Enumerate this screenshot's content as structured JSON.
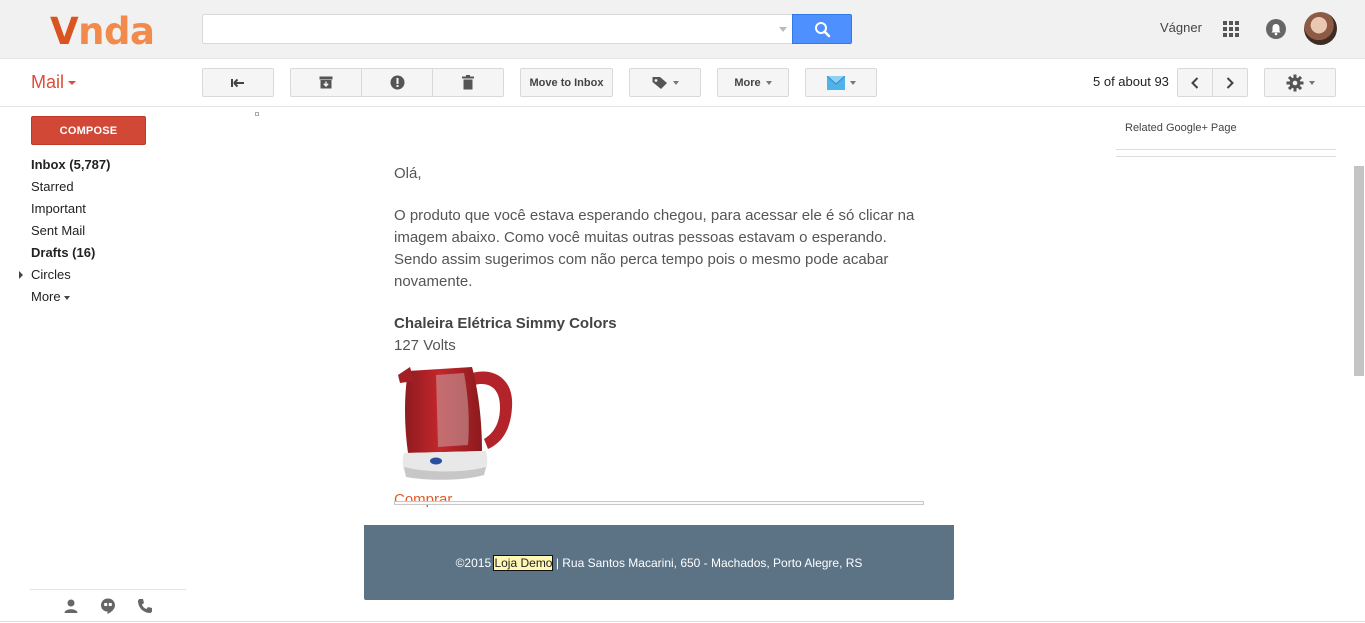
{
  "header": {
    "logo_v": "V",
    "logo_rest": "nda",
    "search_value": "",
    "user_name": "Vágner"
  },
  "toolbar": {
    "mail_label": "Mail",
    "move_to_inbox": "Move to Inbox",
    "more": "More",
    "pager": "5 of about 93"
  },
  "nav": {
    "compose": "COMPOSE",
    "items": [
      {
        "label": "Inbox (5,787)"
      },
      {
        "label": "Starred"
      },
      {
        "label": "Important"
      },
      {
        "label": "Sent Mail"
      },
      {
        "label": "Drafts (16)"
      },
      {
        "label": "Circles"
      },
      {
        "label": "More"
      }
    ]
  },
  "email": {
    "greeting": "Olá,",
    "body": "O produto que você estava esperando chegou, para acessar ele é só clicar na imagem abaixo. Como você muitas outras pessoas estavam o esperando. Sendo assim sugerimos com não perca tempo pois o mesmo pode acabar novamente.",
    "product_name": "Chaleira Elétrica Simmy Colors",
    "product_voltage": "127 Volts",
    "buy_link": "Comprar",
    "footer_prefix": "©2015 ",
    "footer_store": "Loja Demo",
    "footer_suffix": " | Rua Santos Macarini, 650 - Machados, Porto Alegre, RS"
  },
  "right_panel": {
    "related": "Related Google+ Page"
  },
  "colors": {
    "accent_red": "#dd4b39",
    "search_blue": "#4d90fe",
    "footer_band": "#5c7386",
    "link_orange": "#e25a2a"
  }
}
